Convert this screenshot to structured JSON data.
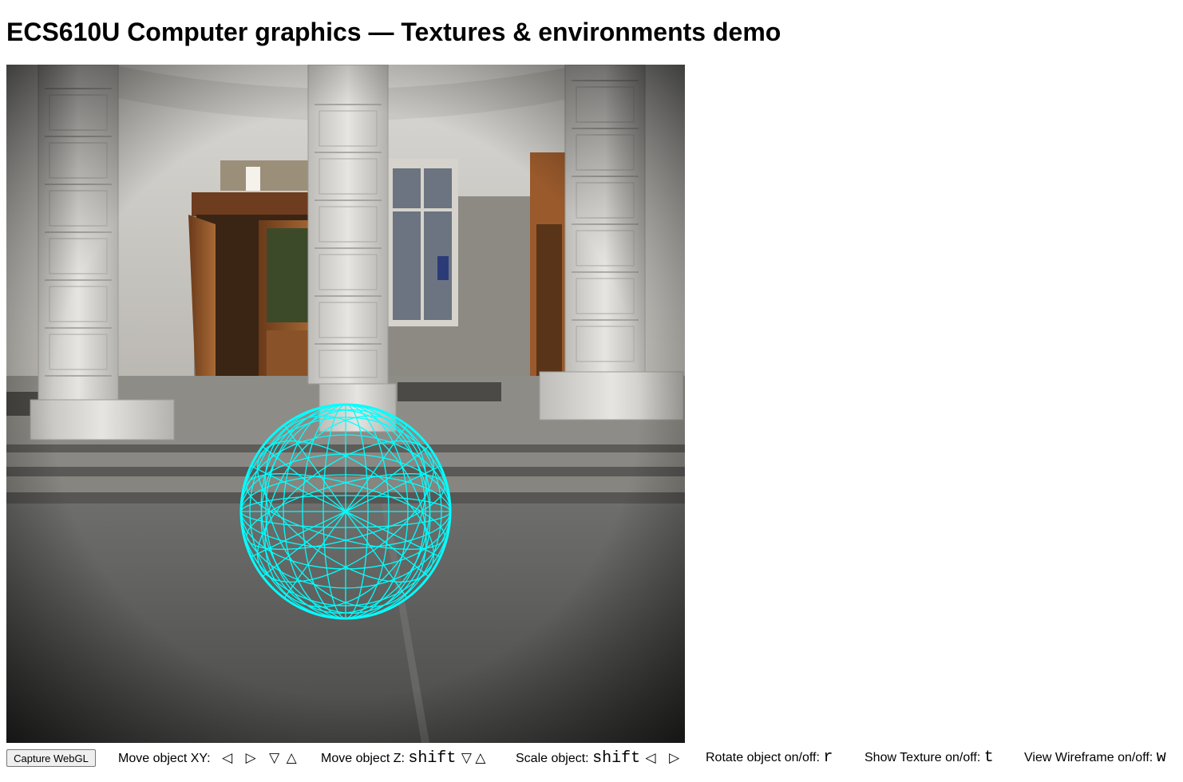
{
  "page": {
    "title": "ECS610U Computer graphics — Textures & environments demo"
  },
  "scene": {
    "environment": "stone colonnade entrance with wooden doors and steps",
    "object": "sphere",
    "wireframe_color": "#00ffff",
    "sky_color": "#cfcfcc",
    "ground_color": "#5a5a5a"
  },
  "controls": {
    "capture_button": "Capture WebGL",
    "move_xy": {
      "label": "Move object XY:",
      "left": "◁",
      "right": "▷",
      "down": "▽",
      "up": "△"
    },
    "move_z": {
      "label": "Move object Z:",
      "modifier": "shift",
      "down": "▽",
      "up": "△"
    },
    "scale": {
      "label": "Scale object:",
      "modifier": "shift",
      "left": "◁",
      "right": "▷"
    },
    "rotate": {
      "label": "Rotate object on/off:",
      "key": "r"
    },
    "texture": {
      "label": "Show Texture on/off:",
      "key": "t"
    },
    "wireframe": {
      "label": "View Wireframe on/off:",
      "key": "w"
    }
  }
}
